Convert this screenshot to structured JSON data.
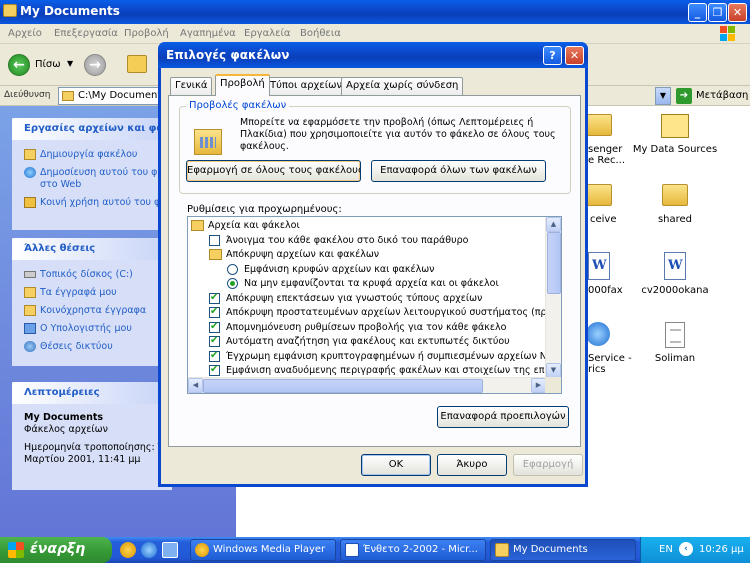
{
  "explorer": {
    "title": "My Documents",
    "menu": [
      "Αρχείο",
      "Επεξεργασία",
      "Προβολή",
      "Αγαπημένα",
      "Εργαλεία",
      "Βοήθεια"
    ],
    "back_label": "Πίσω",
    "address_label": "Διεύθυνση",
    "address_value": "C:\\My Documents",
    "go_label": "Μετάβαση"
  },
  "taskpane": {
    "file_tasks_title": "Εργασίες αρχείων και φακ",
    "file_tasks": [
      "Δημιουργία φακέλου",
      "Δημοσίευση αυτού του φ",
      "στο Web",
      "Κοινή χρήση αυτού του φ"
    ],
    "other_places_title": "Άλλες θέσεις",
    "other_places": [
      "Τοπικός δίσκος (C:)",
      "Τα έγγραφά μου",
      "Κοινόχρηστα έγγραφα",
      "Ο Υπολογιστής μου",
      "Θέσεις δικτύου"
    ],
    "details_title": "Λεπτομέρειες",
    "details_name": "My Documents",
    "details_type": "Φάκελος αρχείων",
    "details_modified_label": "Ημερομηνία τροποποίησης: Τρ",
    "details_modified_value": "Μαρτίου 2001, 11:41 μμ"
  },
  "files": [
    {
      "label1": "senger",
      "label2": "e Rec..."
    },
    {
      "label1": "My Data Sources",
      "label2": ""
    },
    {
      "label1": "ceive",
      "label2": ""
    },
    {
      "label1": "shared",
      "label2": ""
    },
    {
      "label1": "000fax",
      "label2": ""
    },
    {
      "label1": "cv2000okana",
      "label2": ""
    },
    {
      "label1": "Service -",
      "label2": "rics"
    },
    {
      "label1": "Soliman",
      "label2": ""
    }
  ],
  "dialog": {
    "title": "Επιλογές φακέλων",
    "help_glyph": "?",
    "close_glyph": "✕",
    "tabs": [
      "Γενικά",
      "Προβολή",
      "Τύποι αρχείων",
      "Αρχεία χωρίς σύνδεση"
    ],
    "active_tab": "Προβολή",
    "group_title": "Προβολές φακέλων",
    "group_desc": "Μπορείτε να εφαρμόσετε την προβολή (όπως Λεπτομέρειες ή Πλακίδια) που χρησιμοποιείτε για αυτόν το φάκελο σε όλους τους φακέλους.",
    "apply_all": "Εφαρμογή σε όλους τους φακέλους",
    "reset_all": "Επαναφορά όλων των φακέλων",
    "advanced_label": "Ρυθμίσεις για προχωρημένους:",
    "advanced_items": [
      {
        "kind": "folder",
        "indent": 0,
        "text": "Αρχεία και φάκελοι"
      },
      {
        "kind": "check",
        "checked": false,
        "indent": 1,
        "text": "Άνοιγμα του κάθε φακέλου στο δικό του παράθυρο"
      },
      {
        "kind": "folder",
        "indent": 1,
        "text": "Απόκρυψη αρχείων και φακέλων"
      },
      {
        "kind": "radio",
        "checked": false,
        "indent": 2,
        "text": "Εμφάνιση κρυφών αρχείων και φακέλων"
      },
      {
        "kind": "radio",
        "checked": true,
        "indent": 2,
        "text": "Να μην εμφανίζονται τα κρυφά αρχεία και οι φάκελοι"
      },
      {
        "kind": "check",
        "checked": true,
        "indent": 1,
        "text": "Απόκρυψη επεκτάσεων για γνωστούς τύπους αρχείων"
      },
      {
        "kind": "check",
        "checked": true,
        "indent": 1,
        "text": "Απόκρυψη προστατευμένων αρχείων λειτουργικού συστήματος (πρ"
      },
      {
        "kind": "check",
        "checked": true,
        "indent": 1,
        "text": "Απομνημόνευση ρυθμίσεων προβολής για τον κάθε φάκελο"
      },
      {
        "kind": "check",
        "checked": true,
        "indent": 1,
        "text": "Αυτόματη αναζήτηση για φακέλους και εκτυπωτές δικτύου"
      },
      {
        "kind": "check",
        "checked": true,
        "indent": 1,
        "text": "Έγχρωμη εμφάνιση κρυπτογραφημένων ή συμπιεσμένων αρχείων Ν"
      },
      {
        "kind": "check",
        "checked": true,
        "indent": 1,
        "text": "Εμφάνιση αναδυόμενης περιγραφής φακέλων και στοιχείων της επ"
      }
    ],
    "restore_defaults": "Επαναφορά προεπιλογών",
    "ok": "OK",
    "cancel": "Άκυρο",
    "apply": "Εφαρμογή"
  },
  "taskbar": {
    "start": "έναρξη",
    "buttons": [
      "Windows Media Player",
      "Ένθετο 2-2002 - Micr...",
      "My Documents"
    ],
    "language": "EN",
    "clock": "10:26 μμ"
  },
  "colors": {
    "xp_blue": "#0a48d0",
    "start_green": "#379b37",
    "taskpane_link": "#215dc6"
  }
}
